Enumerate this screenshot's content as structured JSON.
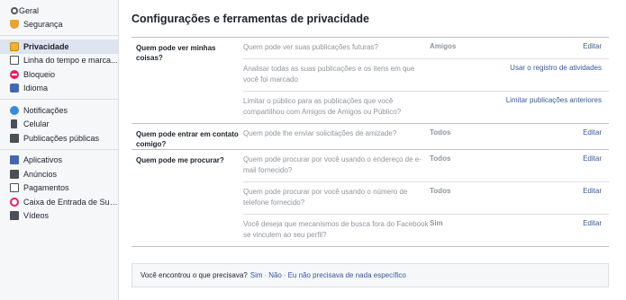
{
  "sidebar": {
    "groups": [
      [
        {
          "label": "Geral",
          "icon": "gear-icon"
        },
        {
          "label": "Segurança",
          "icon": "shield-icon"
        }
      ],
      [
        {
          "label": "Privacidade",
          "icon": "lock-icon",
          "active": true
        },
        {
          "label": "Linha do tempo e marca...",
          "icon": "timeline-icon"
        },
        {
          "label": "Bloqueio",
          "icon": "block-icon"
        },
        {
          "label": "Idioma",
          "icon": "language-icon"
        }
      ],
      [
        {
          "label": "Notificações",
          "icon": "globe-icon"
        },
        {
          "label": "Celular",
          "icon": "phone-icon"
        },
        {
          "label": "Publicações públicas",
          "icon": "rss-icon"
        }
      ],
      [
        {
          "label": "Aplicativos",
          "icon": "apps-icon"
        },
        {
          "label": "Anúncios",
          "icon": "ads-icon"
        },
        {
          "label": "Pagamentos",
          "icon": "payment-icon"
        },
        {
          "label": "Caixa de Entrada de Sup...",
          "icon": "support-icon"
        },
        {
          "label": "Vídeos",
          "icon": "video-icon"
        }
      ]
    ]
  },
  "main": {
    "title": "Configurações e ferramentas de privacidade",
    "sections": [
      {
        "label": "Quem pode ver minhas coisas?",
        "rows": [
          {
            "desc": "Quem pode ver suas publicações futuras?",
            "value": "Amigos",
            "action": "Editar"
          },
          {
            "desc": "Analisar todas as suas publicações e os itens em que você foi marcado",
            "value": "",
            "action": "Usar o registro de atividades"
          },
          {
            "desc": "Limitar o público para as publicações que você compartilhou com Amigos de Amigos ou Público?",
            "value": "",
            "action": "Limitar publicações anteriores"
          }
        ]
      },
      {
        "label": "Quem pode entrar em contato comigo?",
        "rows": [
          {
            "desc": "Quem pode lhe enviar solicitações de amizade?",
            "value": "Todos",
            "action": "Editar"
          }
        ]
      },
      {
        "label": "Quem pode me procurar?",
        "rows": [
          {
            "desc": "Quem pode procurar por você usando o endereço de e-mail fornecido?",
            "value": "Todos",
            "action": "Editar"
          },
          {
            "desc": "Quem pode procurar por você usando o número de telefone fornecido?",
            "value": "Todos",
            "action": "Editar"
          },
          {
            "desc": "Você deseja que mecanismos de busca fora do Facebook se vinculem ao seu perfil?",
            "value": "Sim",
            "action": "Editar"
          }
        ]
      }
    ],
    "feedback": {
      "question": "Você encontrou o que precisava?",
      "yes": "Sim",
      "no": "Não",
      "not_specific": "Eu não precisava de nada específico",
      "separator": "·"
    }
  }
}
